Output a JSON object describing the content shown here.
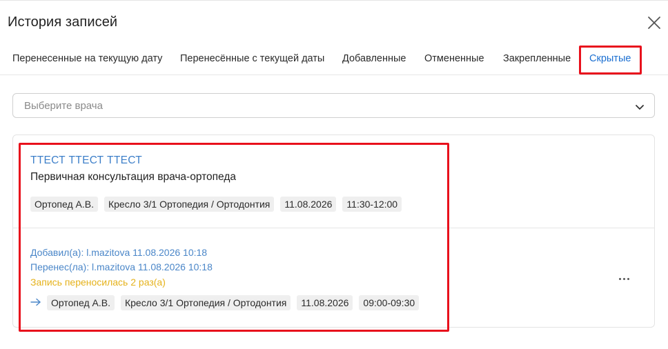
{
  "modal": {
    "title": "История записей"
  },
  "tabs": [
    {
      "label": "Перенесенные на текущую дату",
      "active": false
    },
    {
      "label": "Перенесённые с текущей даты",
      "active": false
    },
    {
      "label": "Добавленные",
      "active": false
    },
    {
      "label": "Отмененные",
      "active": false
    },
    {
      "label": "Закрепленные",
      "active": false
    },
    {
      "label": "Скрытые",
      "active": true
    }
  ],
  "doctor_select": {
    "placeholder": "Выберите врача"
  },
  "record": {
    "patient_name": "ТТЕСТ ТТЕСТ ТТЕСТ",
    "service": "Первичная консультация врача-ортопеда",
    "current": {
      "doctor": "Ортопед А.В.",
      "chair": "Кресло 3/1 Ортопедия / Ортодонтия",
      "date": "11.08.2026",
      "time": "11:30-12:00"
    },
    "history": {
      "added": "Добавил(а): l.mazitova 11.08.2026 10:18",
      "moved": "Перенес(ла): l.mazitova 11.08.2026 10:18",
      "moved_count": "Запись переносилась 2 раз(а)",
      "previous": {
        "doctor": "Ортопед А.В.",
        "chair": "Кресло 3/1 Ортопедия / Ортодонтия",
        "date": "11.08.2026",
        "time": "09:00-09:30"
      }
    }
  },
  "colors": {
    "accent": "#1b6fd1",
    "link": "#3d7fc9",
    "warning": "#e5b21b",
    "highlight": "#e8101c"
  }
}
